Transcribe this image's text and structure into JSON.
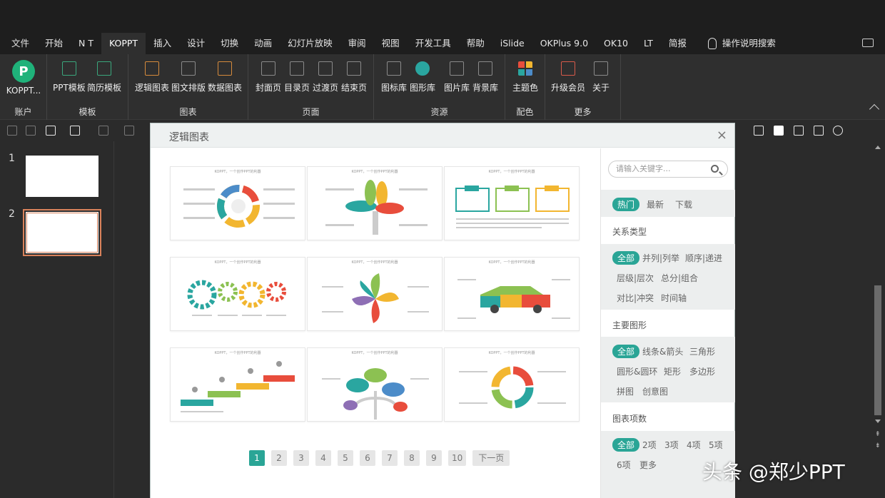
{
  "menu": {
    "items": [
      "文件",
      "开始",
      "N T",
      "KOPPT",
      "插入",
      "设计",
      "切换",
      "动画",
      "幻灯片放映",
      "审阅",
      "视图",
      "开发工具",
      "帮助",
      "iSlide",
      "OKPlus 9.0",
      "OK10",
      "LT",
      "简报"
    ],
    "active_index": 3,
    "search_label": "操作说明搜索"
  },
  "ribbon": {
    "account": {
      "button": "KOPPT...",
      "title": "账户"
    },
    "templates": {
      "buttons": [
        "PPT模板",
        "简历模板"
      ],
      "title": "模板"
    },
    "charts": {
      "buttons": [
        "逻辑图表",
        "图文排版",
        "数据图表"
      ],
      "title": "图表"
    },
    "pages": {
      "buttons": [
        "封面页",
        "目录页",
        "过渡页",
        "结束页"
      ],
      "title": "页面"
    },
    "resources": {
      "buttons": [
        "图标库",
        "图形库",
        "图片库",
        "背景库"
      ],
      "title": "资源"
    },
    "colors": {
      "buttons": [
        "主题色"
      ],
      "title": "配色"
    },
    "more": {
      "buttons": [
        "升级会员",
        "关于"
      ],
      "title": "更多"
    }
  },
  "slides": {
    "numbers": [
      "1",
      "2"
    ],
    "selected": 2
  },
  "dialog": {
    "title": "逻辑图表",
    "close": "×",
    "card_caption": "KOPPT，一个创作PPT的利器",
    "pagination": [
      "1",
      "2",
      "3",
      "4",
      "5",
      "6",
      "7",
      "8",
      "9",
      "10"
    ],
    "active_page": "1",
    "next_label": "下一页",
    "search_placeholder": "请输入关键字...",
    "sort_tabs": [
      "热门",
      "最新",
      "下载"
    ],
    "relation": {
      "heading": "关系类型",
      "options": [
        "全部",
        "并列|列举",
        "顺序|递进",
        "层级|层次",
        "总分|组合",
        "对比|冲突",
        "时间轴"
      ]
    },
    "shape": {
      "heading": "主要图形",
      "options": [
        "全部",
        "线条&箭头",
        "三角形",
        "圆形&圆环",
        "矩形",
        "多边形",
        "拼图",
        "创意图"
      ]
    },
    "count": {
      "heading": "图表项数",
      "options": [
        "全部",
        "2项",
        "3项",
        "4项",
        "5项",
        "6项",
        "更多"
      ]
    }
  },
  "watermark": "头条 @郑少PPT",
  "colors": {
    "accent": "#2aa596",
    "ribbon_bg": "#2f2f2f",
    "menu_bg": "#1e1e1e"
  }
}
